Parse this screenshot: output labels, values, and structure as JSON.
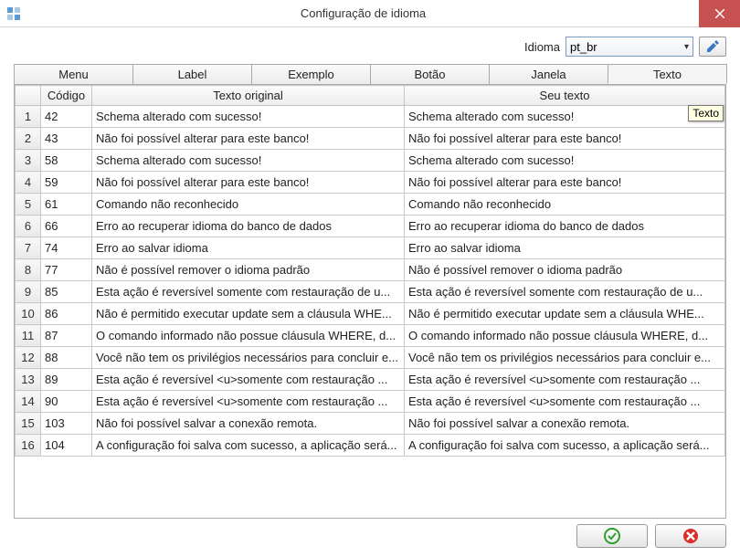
{
  "window": {
    "title": "Configuração de idioma"
  },
  "lang": {
    "label": "Idioma",
    "selected": "pt_br"
  },
  "tabs": {
    "menu": "Menu",
    "label": "Label",
    "exemplo": "Exemplo",
    "botao": "Botão",
    "janela": "Janela",
    "texto": "Texto"
  },
  "columns": {
    "codigo": "Código",
    "original": "Texto original",
    "seu": "Seu texto"
  },
  "tooltip": "Texto",
  "rows": [
    {
      "n": "1",
      "code": "42",
      "orig": "Schema alterado com sucesso!",
      "user": "Schema alterado com sucesso!"
    },
    {
      "n": "2",
      "code": "43",
      "orig": "Não foi possível alterar para este banco!",
      "user": "Não foi possível alterar para este banco!"
    },
    {
      "n": "3",
      "code": "58",
      "orig": "Schema alterado com sucesso!",
      "user": "Schema alterado com sucesso!"
    },
    {
      "n": "4",
      "code": "59",
      "orig": "Não foi possível alterar para este banco!",
      "user": "Não foi possível alterar para este banco!"
    },
    {
      "n": "5",
      "code": "61",
      "orig": "Comando não reconhecido",
      "user": "Comando não reconhecido"
    },
    {
      "n": "6",
      "code": "66",
      "orig": "Erro ao recuperar idioma do banco de dados",
      "user": "Erro ao recuperar idioma do banco de dados"
    },
    {
      "n": "7",
      "code": "74",
      "orig": "Erro ao salvar idioma",
      "user": "Erro ao salvar idioma"
    },
    {
      "n": "8",
      "code": "77",
      "orig": "Não é possível remover o idioma padrão",
      "user": "Não é possível remover o idioma padrão"
    },
    {
      "n": "9",
      "code": "85",
      "orig": "Esta ação é reversível somente com restauração de u...",
      "user": "Esta ação é reversível somente com restauração de u..."
    },
    {
      "n": "10",
      "code": "86",
      "orig": "Não é permitido executar update sem a cláusula WHE...",
      "user": "Não é permitido executar update sem a cláusula WHE..."
    },
    {
      "n": "11",
      "code": "87",
      "orig": "O comando informado não possue cláusula WHERE, d...",
      "user": "O comando informado não possue cláusula WHERE, d..."
    },
    {
      "n": "12",
      "code": "88",
      "orig": "Você não tem os privilégios necessários para concluir e...",
      "user": "Você não tem os privilégios necessários para concluir e..."
    },
    {
      "n": "13",
      "code": "89",
      "orig": "Esta ação é reversível <u>somente com restauração ...",
      "user": "Esta ação é reversível <u>somente com restauração ..."
    },
    {
      "n": "14",
      "code": "90",
      "orig": "Esta ação é reversível <u>somente com restauração ...",
      "user": "Esta ação é reversível <u>somente com restauração ..."
    },
    {
      "n": "15",
      "code": "103",
      "orig": "Não foi possível salvar a conexão remota.",
      "user": "Não foi possível salvar a conexão remota."
    },
    {
      "n": "16",
      "code": "104",
      "orig": "A configuração foi salva com sucesso, a aplicação será...",
      "user": "A configuração foi salva com sucesso, a aplicação será..."
    }
  ]
}
